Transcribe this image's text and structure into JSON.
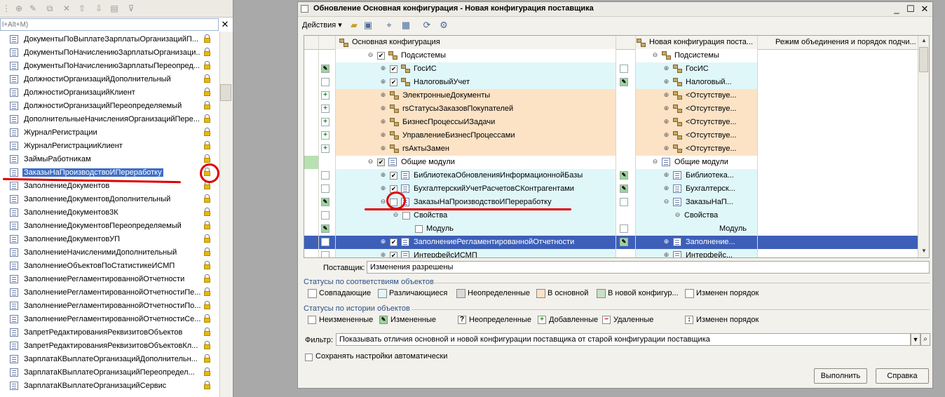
{
  "left_panel": {
    "search_placeholder": "l+Alt+M)",
    "rows": [
      "ДокументыПоВыплатеЗарплатыОрганизацийП...",
      "ДокументыПоНачислениюЗарплатыОрганизаци...",
      "ДокументыПоНачислениюЗарплатыПереопред...",
      "ДолжностиОрганизацийДополнительный",
      "ДолжностиОрганизацийКлиент",
      "ДолжностиОрганизацийПереопределяемый",
      "ДополнительныеНачисленияОрганизацийПере...",
      "ЖурналРегистрации",
      "ЖурналРегистрацииКлиент",
      "ЗаймыРаботникам",
      "ЗаказыНаПроизводствоИПереработку",
      "ЗаполнениеДокументов",
      "ЗаполнениеДокументовДополнительный",
      "ЗаполнениеДокументов3К",
      "ЗаполнениеДокументовПереопределяемый",
      "ЗаполнениеДокументовУП",
      "ЗаполнениеНачисленимиДополнительный",
      "ЗаполнениеОбъектовПоСтатистикеИСМП",
      "ЗаполнениеРегламентированнойОтчетности",
      "ЗаполнениеРегламентированнойОтчетностиПе...",
      "ЗаполнениеРегламентированнойОтчетностиПо...",
      "ЗаполнениеРегламентированнойОтчетностиСе...",
      "ЗапретРедактированияРеквизитовОбъектов",
      "ЗапретРедактированияРеквизитовОбъектовКл...",
      "ЗарплатаКВыплатеОрганизацийДополнительн...",
      "ЗарплатаКВыплатеОрганизацийПереопредел...",
      "ЗарплатаКВыплатеОрганизацийСервис"
    ],
    "selected_index": 10
  },
  "dialog": {
    "title": "Обновление Основная конфигурация - Новая конфигурация поставщика",
    "actions_label": "Действия",
    "columns": {
      "main": "Основная конфигурация",
      "new": "Новая конфигурация поста...",
      "mode": "Режим объединения и порядок подчи..."
    },
    "rows": [
      {
        "main": "Подсистемы",
        "new": "Подсистемы"
      },
      {
        "main": "ГосИС",
        "new": "ГосИС"
      },
      {
        "main": "НалоговыйУчет",
        "new": "Налоговый..."
      },
      {
        "main": "ЭлектронныеДокументы",
        "new": "<Отсутствуе..."
      },
      {
        "main": "rsСтатусыЗаказовПокупателей",
        "new": "<Отсутствуе..."
      },
      {
        "main": "БизнесПроцессыИЗадачи",
        "new": "<Отсутствуе..."
      },
      {
        "main": "УправлениеБизнесПроцессами",
        "new": "<Отсутствуе..."
      },
      {
        "main": "rsАктыЗамен",
        "new": "<Отсутствуе..."
      },
      {
        "main": "Общие модули",
        "new": "Общие модули"
      },
      {
        "main": "БиблиотекаОбновленияИнформационнойБазы",
        "new": "Библиотека..."
      },
      {
        "main": "БухгалтерскийУчетРасчетовСКонтрагентами",
        "new": "Бухгалтерск..."
      },
      {
        "main": "ЗаказыНаПроизводствоИПереработку",
        "new": "ЗаказыНаП..."
      },
      {
        "main": "Свойства",
        "new": "Свойства"
      },
      {
        "main": "Модуль",
        "new": "Модуль"
      },
      {
        "main": "ЗаполнениеРегламентированнойОтчетности",
        "new": "Заполнение..."
      },
      {
        "main": "ИнтерфейсИСМП",
        "new": "Интерфейс..."
      }
    ],
    "supplier_label": "Поставщик:",
    "supplier_value": "Изменения разрешены",
    "status_match_title": "Статусы по соответствиям объектов",
    "status_match": [
      "Совпадающие",
      "Различающиеся",
      "Неопределенные",
      "В основной",
      "В новой конфигур...",
      "Изменен порядок"
    ],
    "status_match_colors": [
      "#ffffff",
      "#e0f7fa",
      "#d9d9d9",
      "#fce3c6",
      "#c8e0c8",
      "#ffffff"
    ],
    "status_history_title": "Статусы по истории объектов",
    "status_history": [
      "Неизмененные",
      "Измененные",
      "Неопределенные",
      "Добавленные",
      "Удаленные",
      "Изменен порядок"
    ],
    "filter_label": "Фильтр:",
    "filter_value": "Показывать отличия основной и новой конфигурации поставщика от старой конфигурации поставщика",
    "save_settings_label": "Сохранять настройки автоматически",
    "execute_label": "Выполнить",
    "help_label": "Справка",
    "colors": {
      "diff": "#e0f7fa",
      "main_only": "#fce3c6",
      "selected": "#3d5fb8"
    }
  }
}
